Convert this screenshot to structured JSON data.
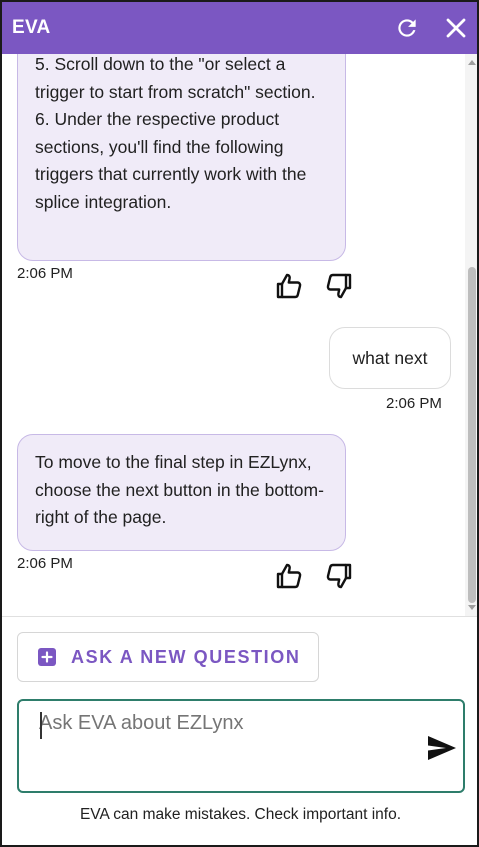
{
  "header": {
    "title": "EVA",
    "refresh_icon": "refresh-icon",
    "close_icon": "close-icon",
    "background_color": "#7b57c2"
  },
  "messages": [
    {
      "role": "assistant",
      "text": "5. Scroll down to the \"or select a trigger to start from scratch\" section.\n6. Under the respective product sections, you'll find the following triggers that currently work with the splice integration.",
      "time": "2:06 PM"
    },
    {
      "role": "user",
      "text": "what next",
      "time": "2:06 PM"
    },
    {
      "role": "assistant",
      "text": "To move to the final step in EZLynx, choose the next button in the bottom-right of the page.",
      "time": "2:06 PM"
    }
  ],
  "feedback_icons": [
    "thumbs-up-icon",
    "thumbs-down-icon"
  ],
  "ask_button": {
    "label": "ASK A NEW QUESTION",
    "icon": "plus-square-icon"
  },
  "input": {
    "placeholder": "Ask EVA about EZLynx",
    "value": ""
  },
  "send_icon": "send-icon",
  "disclaimer": "EVA can make mistakes. Check important info.",
  "colors": {
    "accent": "#7b57c2",
    "bot_bubble": "#f0ebf8",
    "input_border": "#2e7d6b"
  }
}
